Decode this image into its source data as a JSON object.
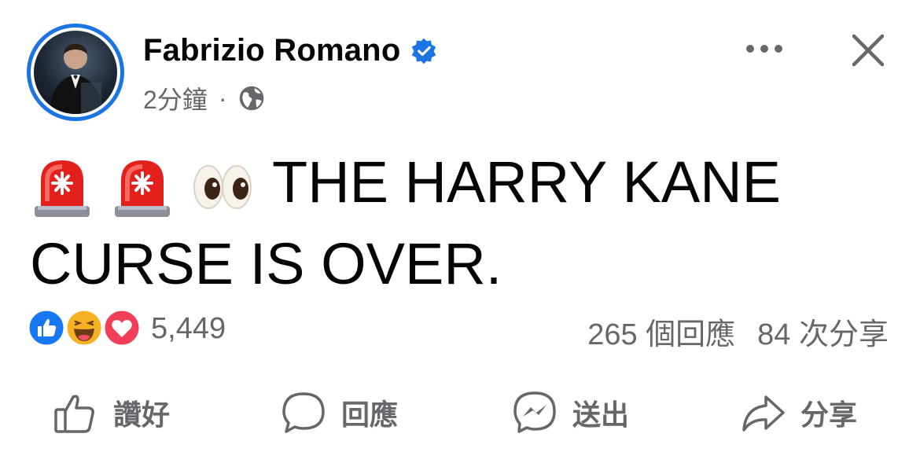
{
  "post": {
    "author": "Fabrizio Romano",
    "time": "2分鐘",
    "separator": "·",
    "text": "THE HARRY KANE CURSE IS OVER."
  },
  "icons": {
    "verified": "verified-badge-icon",
    "audience": "globe-icon",
    "emojis": [
      "police-light-emoji",
      "police-light-emoji",
      "eyes-emoji"
    ],
    "reactions": [
      "like-reaction-icon",
      "haha-reaction-icon",
      "love-reaction-icon"
    ]
  },
  "engagement": {
    "reaction_count": "5,449",
    "comments": "265 個回應",
    "shares": "84 次分享"
  },
  "actions": {
    "like": "讚好",
    "comment": "回應",
    "send": "送出",
    "share": "分享"
  },
  "colors": {
    "accent": "#1b74e4",
    "text": "#050505",
    "muted": "#65676b",
    "like": "#1877f2",
    "love": "#f33e58",
    "haha": "#f7b125"
  }
}
